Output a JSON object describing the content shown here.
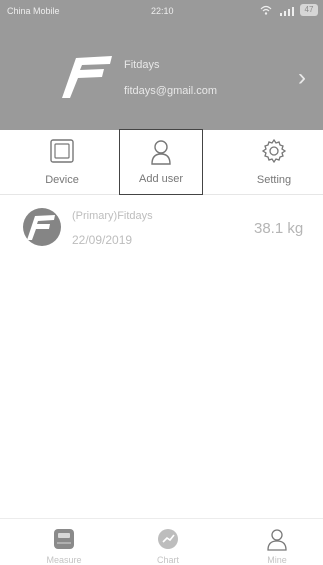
{
  "status_bar": {
    "carrier": "China Mobile",
    "time": "22:10",
    "battery": "47"
  },
  "profile": {
    "name": "Fitdays",
    "email": "fitdays@gmail.com"
  },
  "nav": {
    "device_label": "Device",
    "add_user_label": "Add user",
    "setting_label": "Setting"
  },
  "users": [
    {
      "name": "(Primary)Fitdays",
      "date": "22/09/2019",
      "weight": "38.1 kg"
    }
  ],
  "tabbar": {
    "measure_label": "Measure",
    "chart_label": "Chart",
    "mine_label": "Mine"
  },
  "colors": {
    "header_bg": "#9a9a9a",
    "selection_border": "#444444"
  },
  "icons": [
    "fitdays-logo-icon",
    "chevron-right-icon",
    "device-icon",
    "add-user-icon",
    "gear-icon",
    "scale-icon",
    "chart-icon",
    "user-icon",
    "wifi-icon",
    "signal-icon",
    "battery-icon"
  ]
}
